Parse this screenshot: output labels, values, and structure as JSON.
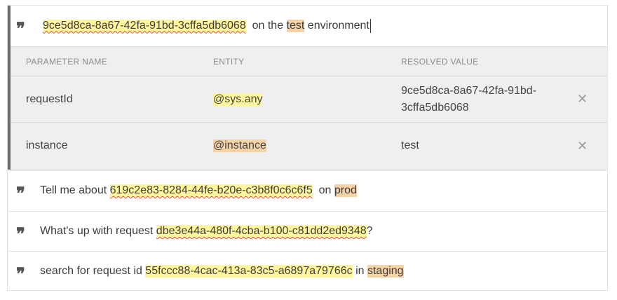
{
  "active_phrase": {
    "parts": [
      {
        "text": "9ce5d8ca-8a67-42fa-91bd-3cffa5db6068",
        "style": "yellow"
      },
      {
        "text": "  on the ",
        "style": "plain"
      },
      {
        "text": "test",
        "style": "orange"
      },
      {
        "text": " environment",
        "style": "plain"
      }
    ]
  },
  "parameters": {
    "headers": {
      "name": "PARAMETER NAME",
      "entity": "ENTITY",
      "value": "RESOLVED VALUE"
    },
    "rows": [
      {
        "name": "requestId",
        "entity": "@sys.any",
        "value": "9ce5d8ca-8a67-42fa-91bd-3cffa5db6068"
      },
      {
        "name": "instance",
        "entity": "@instance",
        "value": "test"
      }
    ]
  },
  "phrases": [
    {
      "parts": [
        {
          "text": "Tell me about ",
          "style": "plain"
        },
        {
          "text": "619c2e83-8284-44fe-b20e-c3b8f0c6c6f5",
          "style": "yellow"
        },
        {
          "text": "  on ",
          "style": "plain"
        },
        {
          "text": "prod",
          "style": "orange"
        }
      ]
    },
    {
      "parts": [
        {
          "text": "What's up with request ",
          "style": "plain"
        },
        {
          "text": "dbe3e44a-480f-4cba-b100-c81dd2ed9348",
          "style": "yellow"
        },
        {
          "text": "?",
          "style": "plain"
        }
      ]
    },
    {
      "parts": [
        {
          "text": "search for request id ",
          "style": "plain"
        },
        {
          "text": "55fccc88-4cac-413a-83c5-a6897a79766c",
          "style": "yellow-plain"
        },
        {
          "text": " in ",
          "style": "plain"
        },
        {
          "text": "staging",
          "style": "orange"
        }
      ]
    }
  ],
  "icons": {
    "quote": "❞",
    "delete": "✕"
  },
  "colors": {
    "entity_any": "#fff59d",
    "entity_custom": "#f6d3a6",
    "active_border": "#6d6d6d"
  }
}
